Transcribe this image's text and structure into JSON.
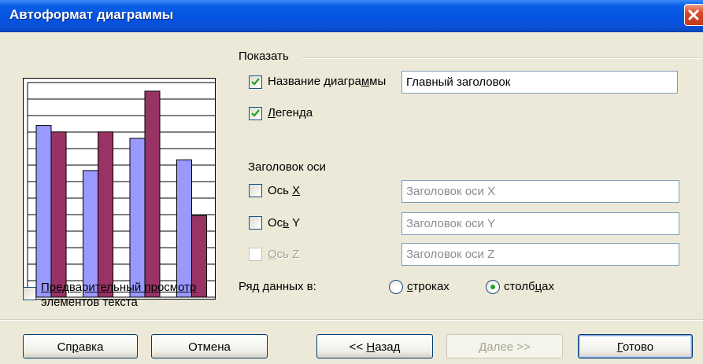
{
  "window": {
    "title": "Автоформат диаграммы"
  },
  "colors": {
    "series1": "#9999ff",
    "series2": "#993366",
    "titlebar": "#0454e3"
  },
  "preview": {
    "categories": 4,
    "series1_values": [
      0.8,
      0.59,
      0.74,
      0.64
    ],
    "series2_values": [
      0.77,
      0.77,
      0.96,
      0.38
    ],
    "checkbox_label_line1": "Предварительный просмотр",
    "checkbox_label_line2": "элементов текста",
    "checked": false
  },
  "show_group": {
    "label": "Показать",
    "chart_title": {
      "label_pre": "Название диагра",
      "label_u": "м",
      "label_post": "мы",
      "checked": true,
      "value": "Главный заголовок"
    },
    "legend": {
      "label_u": "Л",
      "label_post": "егенда",
      "checked": true
    }
  },
  "axis_group": {
    "label": "Заголовок оси",
    "x": {
      "label_pre": "Ось ",
      "label_u": "X",
      "checked": false,
      "placeholder": "Заголовок оси X"
    },
    "y": {
      "label_pre": "Ос",
      "label_u": "ь",
      "label_post": " Y",
      "checked": false,
      "placeholder": "Заголовок оси Y"
    },
    "z": {
      "label_u": "О",
      "label_post": "сь Z",
      "checked": false,
      "disabled": true,
      "placeholder": "Заголовок оси Z"
    }
  },
  "series_in": {
    "label": "Ряд данных в:",
    "rows": {
      "label_u": "с",
      "label_post": "троках",
      "selected": false
    },
    "cols": {
      "label_pre": "столб",
      "label_u": "ц",
      "label_post": "ах",
      "selected": true
    }
  },
  "buttons": {
    "help": {
      "pre": "Сп",
      "u": "р",
      "post": "авка"
    },
    "cancel": "Отмена",
    "back": {
      "pre": "<< ",
      "u": "Н",
      "post": "азад"
    },
    "next": {
      "u": "Д",
      "post": "алее >>"
    },
    "finish": {
      "u": "Г",
      "post": "отово"
    }
  }
}
